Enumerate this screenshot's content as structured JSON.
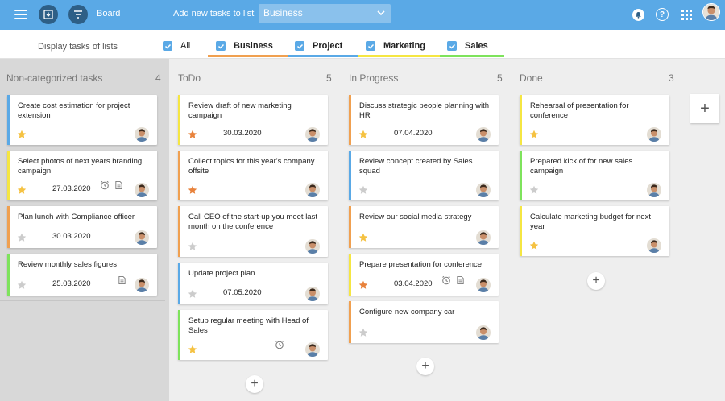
{
  "topbar": {
    "board_label": "Board",
    "add_label": "Add new tasks to list",
    "list_select_value": "Business"
  },
  "filterbar": {
    "display_label": "Display tasks of lists",
    "items": [
      {
        "label": "All",
        "checked": true
      },
      {
        "label": "Business",
        "checked": true,
        "color": "#f0a050"
      },
      {
        "label": "Project",
        "checked": true,
        "color": "#5aa9e6"
      },
      {
        "label": "Marketing",
        "checked": true,
        "color": "#f5e642"
      },
      {
        "label": "Sales",
        "checked": true,
        "color": "#7ee35c"
      }
    ]
  },
  "colors": {
    "accent": "#5aa9e6",
    "business": "#f0a050",
    "project": "#5aa9e6",
    "marketing": "#f5e642",
    "sales": "#7ee35c",
    "star_gold": "#f5c242",
    "star_orange": "#e8823c",
    "star_grey": "#cccccc"
  },
  "columns": [
    {
      "title": "Non-categorized tasks",
      "count": "4",
      "cards": [
        {
          "title": "Create cost estimation for project extension",
          "list": "project",
          "star": "gold",
          "date": "",
          "alarm": false,
          "note": false
        },
        {
          "title": "Select photos of next years branding campaign",
          "list": "marketing",
          "star": "gold",
          "date": "27.03.2020",
          "alarm": true,
          "note": true
        },
        {
          "title": "Plan lunch with Compliance officer",
          "list": "business",
          "star": "grey",
          "date": "30.03.2020",
          "alarm": false,
          "note": false
        },
        {
          "title": "Review monthly sales figures",
          "list": "sales",
          "star": "grey",
          "date": "25.03.2020",
          "alarm": false,
          "note": true
        }
      ]
    },
    {
      "title": "ToDo",
      "count": "5",
      "cards": [
        {
          "title": "Review draft of new marketing campaign",
          "list": "marketing",
          "star": "orange",
          "date": "30.03.2020",
          "alarm": false,
          "note": false
        },
        {
          "title": "Collect topics for this year's company offsite",
          "list": "business",
          "star": "orange",
          "date": "",
          "alarm": false,
          "note": false
        },
        {
          "title": "Call CEO of the start-up you meet last month on the conference",
          "list": "business",
          "star": "grey",
          "date": "",
          "alarm": false,
          "note": false
        },
        {
          "title": "Update project plan",
          "list": "project",
          "star": "grey",
          "date": "07.05.2020",
          "alarm": false,
          "note": false
        },
        {
          "title": "Setup regular meeting with Head of Sales",
          "list": "sales",
          "star": "gold",
          "date": "",
          "alarm": true,
          "note": false
        }
      ]
    },
    {
      "title": "In Progress",
      "count": "5",
      "cards": [
        {
          "title": "Discuss strategic people planning with HR",
          "list": "business",
          "star": "gold",
          "date": "07.04.2020",
          "alarm": false,
          "note": false
        },
        {
          "title": "Review concept created by Sales squad",
          "list": "project",
          "star": "grey",
          "date": "",
          "alarm": false,
          "note": false
        },
        {
          "title": "Review our social media strategy",
          "list": "business",
          "star": "gold",
          "date": "",
          "alarm": false,
          "note": false
        },
        {
          "title": "Prepare presentation for conference",
          "list": "marketing",
          "star": "orange",
          "date": "03.04.2020",
          "alarm": true,
          "note": true
        },
        {
          "title": "Configure new company car",
          "list": "business",
          "star": "grey",
          "date": "",
          "alarm": false,
          "note": false
        }
      ]
    },
    {
      "title": "Done",
      "count": "3",
      "cards": [
        {
          "title": "Rehearsal of presentation for conference",
          "list": "marketing",
          "star": "gold",
          "date": "",
          "alarm": false,
          "note": false
        },
        {
          "title": "Prepared kick of for new sales campaign",
          "list": "sales",
          "star": "grey",
          "date": "",
          "alarm": false,
          "note": false
        },
        {
          "title": "Calculate marketing budget for next year",
          "list": "marketing",
          "star": "gold",
          "date": "",
          "alarm": false,
          "note": false
        }
      ]
    }
  ]
}
